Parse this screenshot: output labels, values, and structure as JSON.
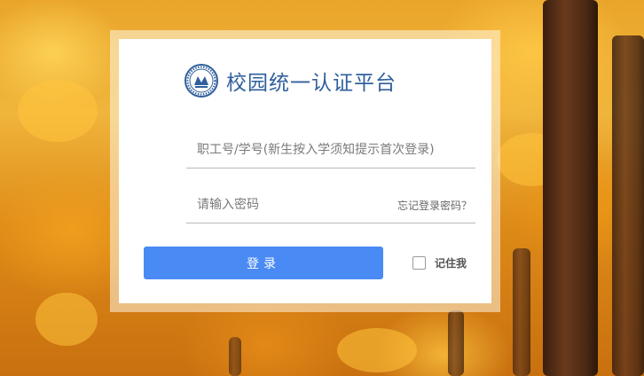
{
  "background": {
    "description_icon": "autumn-trees-background"
  },
  "brand": {
    "title": "校园统一认证平台",
    "logo_icon": "university-seal-icon",
    "accent_color": "#2f5f9c"
  },
  "form": {
    "username_placeholder": "职工号/学号(新生按入学须知提示首次登录)",
    "username_value": "",
    "password_placeholder": "请输入密码",
    "password_value": "",
    "forgot_label": "忘记登录密码？",
    "login_label": "登录",
    "login_color": "#4a8af4",
    "remember_label": "记住我",
    "remember_checked": false
  }
}
